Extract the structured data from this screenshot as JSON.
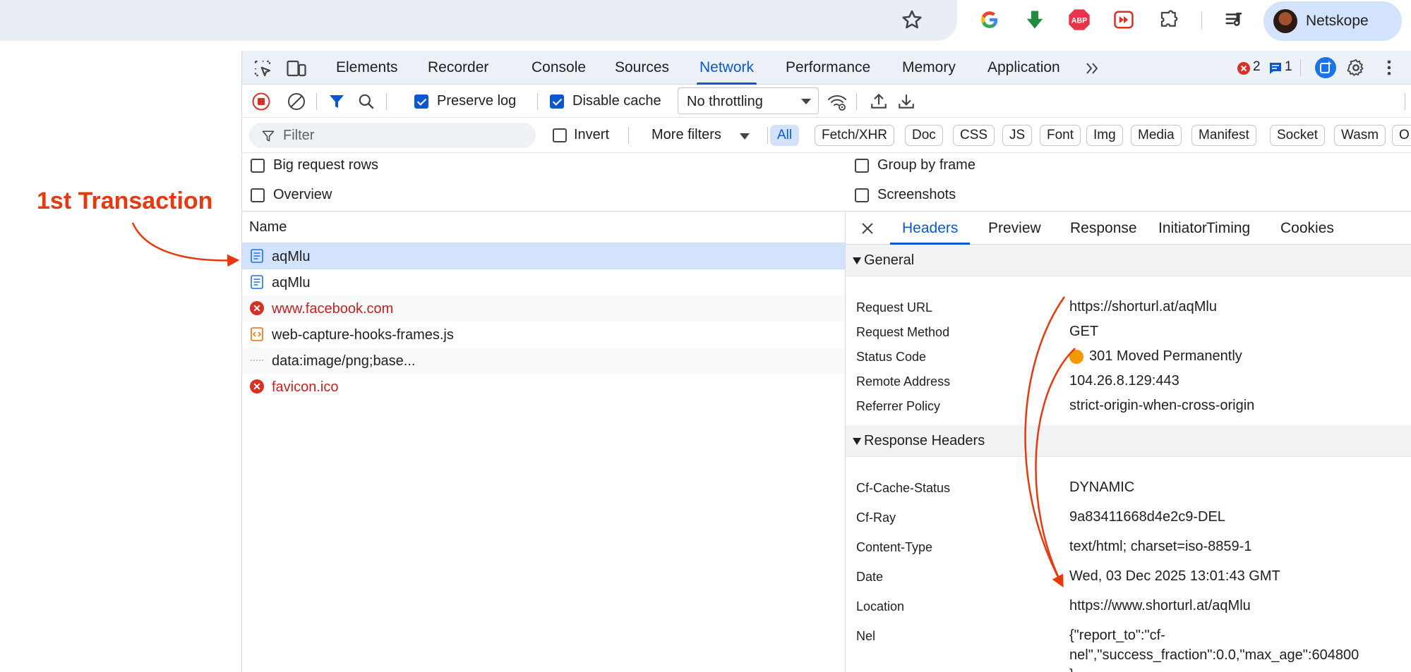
{
  "browser": {
    "profile_name": "Netskope",
    "extensions": [
      "google-icon",
      "download-arrow-icon",
      "adblock-plus-icon",
      "media-forward-icon",
      "puzzle-extensions-icon",
      "media-queue-icon"
    ]
  },
  "devtools": {
    "tabs": [
      "Elements",
      "Recorder",
      "Console",
      "Sources",
      "Network",
      "Performance",
      "Memory",
      "Application"
    ],
    "active_tab": "Network",
    "error_count": "2",
    "message_count": "1",
    "toolbar": {
      "preserve_log_label": "Preserve log",
      "preserve_log_checked": true,
      "disable_cache_label": "Disable cache",
      "disable_cache_checked": true,
      "throttling": "No throttling"
    },
    "filter_bar": {
      "filter_placeholder": "Filter",
      "invert_label": "Invert",
      "more_filters_label": "More filters",
      "chips": [
        "All",
        "Fetch/XHR",
        "Doc",
        "CSS",
        "JS",
        "Font",
        "Img",
        "Media",
        "Manifest",
        "Socket",
        "Wasm",
        "O"
      ],
      "active_chip": "All"
    },
    "settings": {
      "big_request_rows": "Big request rows",
      "overview": "Overview",
      "group_by_frame": "Group by frame",
      "screenshots": "Screenshots"
    },
    "requests": {
      "column_name": "Name",
      "rows": [
        {
          "name": "aqMlu",
          "type": "document",
          "error": false,
          "selected": true
        },
        {
          "name": "aqMlu",
          "type": "document",
          "error": false,
          "selected": false
        },
        {
          "name": "www.facebook.com",
          "type": "error",
          "error": true,
          "selected": false
        },
        {
          "name": "web-capture-hooks-frames.js",
          "type": "script",
          "error": false,
          "selected": false
        },
        {
          "name": "data:image/png;base...",
          "type": "data",
          "error": false,
          "selected": false
        },
        {
          "name": "favicon.ico",
          "type": "error",
          "error": true,
          "selected": false
        }
      ]
    },
    "details": {
      "tabs": [
        "Headers",
        "Preview",
        "Response",
        "Initiator",
        "Timing",
        "Cookies"
      ],
      "active_tab": "Headers",
      "general_title": "General",
      "general": [
        {
          "key": "Request URL",
          "value": "https://shorturl.at/aqMlu"
        },
        {
          "key": "Request Method",
          "value": "GET"
        },
        {
          "key": "Status Code",
          "value": "301 Moved Permanently"
        },
        {
          "key": "Remote Address",
          "value": "104.26.8.129:443"
        },
        {
          "key": "Referrer Policy",
          "value": "strict-origin-when-cross-origin"
        }
      ],
      "response_headers_title": "Response Headers",
      "response_headers": [
        {
          "key": "Cf-Cache-Status",
          "value": "DYNAMIC"
        },
        {
          "key": "Cf-Ray",
          "value": "9a83411668d4e2c9-DEL"
        },
        {
          "key": "Content-Type",
          "value": "text/html; charset=iso-8859-1"
        },
        {
          "key": "Date",
          "value": "Wed, 03 Dec 2025 13:01:43 GMT"
        },
        {
          "key": "Location",
          "value": "https://www.shorturl.at/aqMlu"
        },
        {
          "key": "Nel",
          "value_lines": [
            "{\"report_to\":\"cf-",
            "nel\",\"success_fraction\":0.0,\"max_age\":604800",
            "}"
          ]
        }
      ]
    }
  },
  "annotation": {
    "label": "1st Transaction",
    "color": "#e8380d"
  }
}
